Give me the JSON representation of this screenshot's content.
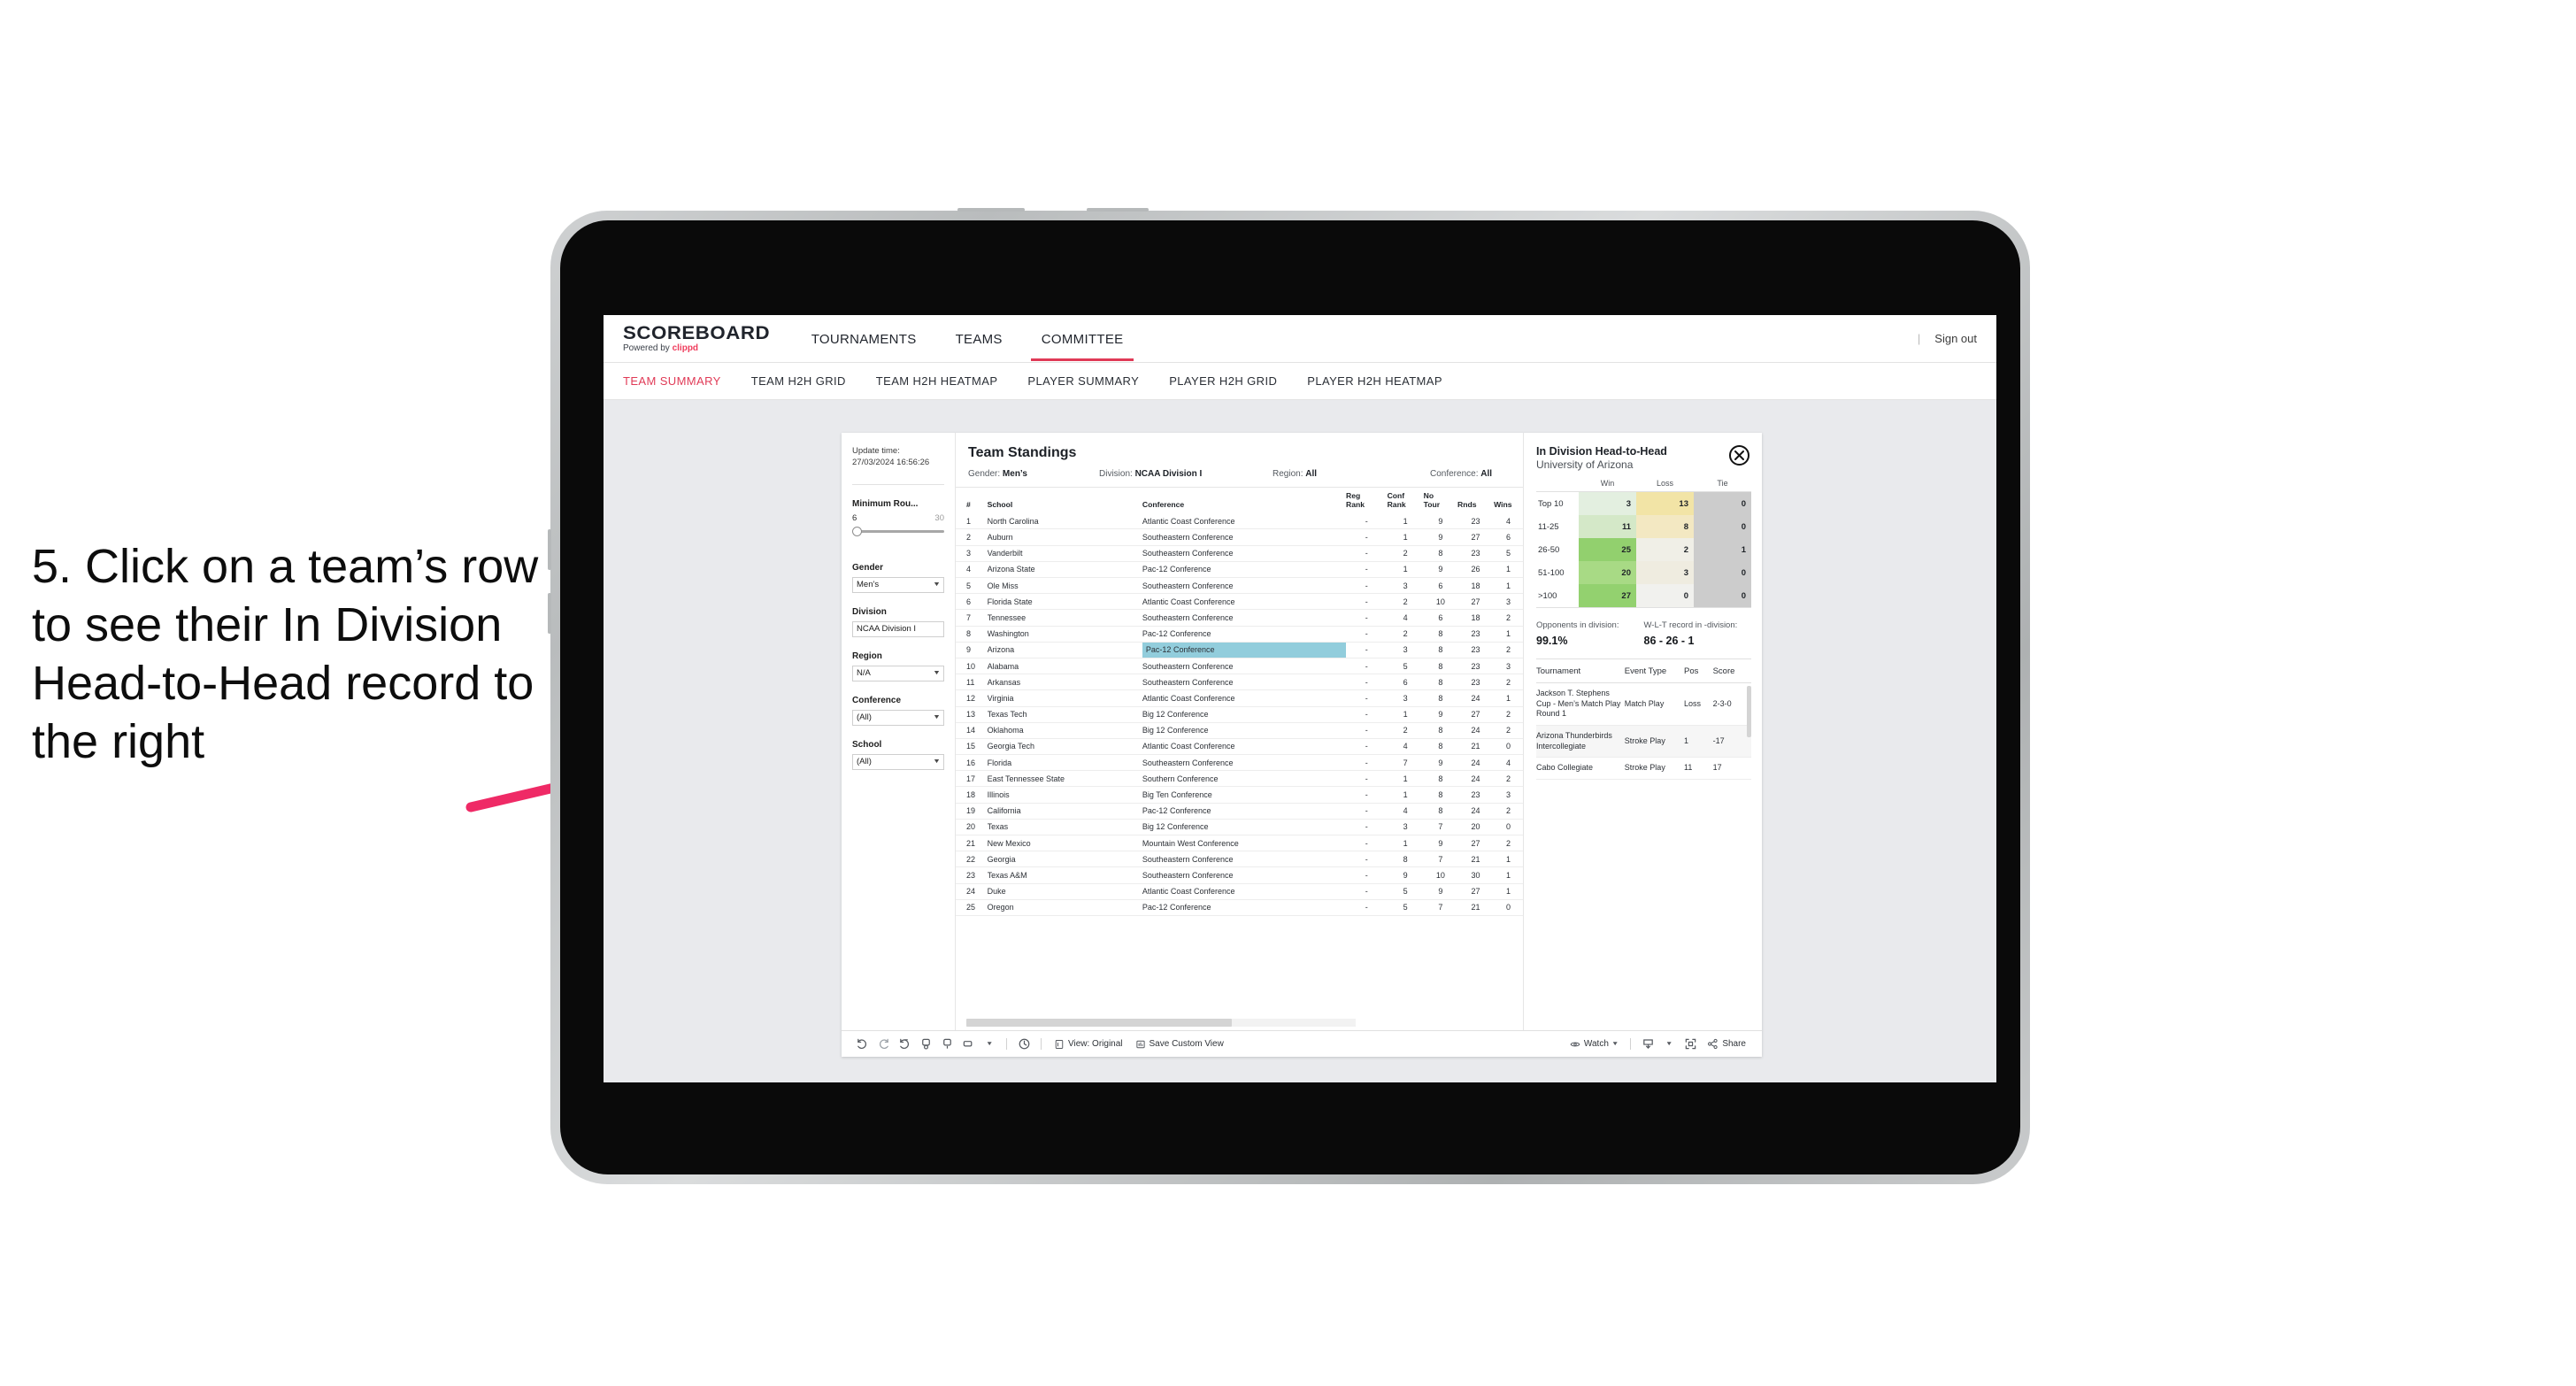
{
  "instruction": "5. Click on a team’s row to see their In Division Head-to-Head record to the right",
  "colors": {
    "accent": "#e03a56",
    "arrow": "#ef2a66",
    "highlight": "#92cddc"
  },
  "header": {
    "logo_main": "SCOREBOARD",
    "logo_powered": "Powered by ",
    "logo_brand": "clippd",
    "nav": [
      {
        "label": "TOURNAMENTS",
        "active": false
      },
      {
        "label": "TEAMS",
        "active": false
      },
      {
        "label": "COMMITTEE",
        "active": true
      }
    ],
    "divider": "|",
    "sign_out": "Sign out"
  },
  "subnav": [
    {
      "label": "TEAM SUMMARY",
      "active": true
    },
    {
      "label": "TEAM H2H GRID",
      "active": false
    },
    {
      "label": "TEAM H2H HEATMAP",
      "active": false
    },
    {
      "label": "PLAYER SUMMARY",
      "active": false
    },
    {
      "label": "PLAYER H2H GRID",
      "active": false
    },
    {
      "label": "PLAYER H2H HEATMAP",
      "active": false
    }
  ],
  "filters": {
    "update_label": "Update time:",
    "update_value": "27/03/2024 16:56:26",
    "min_rounds": {
      "label": "Minimum Rou...",
      "min": "6",
      "max": "30"
    },
    "gender": {
      "label": "Gender",
      "value": "Men’s"
    },
    "division": {
      "label": "Division",
      "value": "NCAA Division I"
    },
    "region": {
      "label": "Region",
      "value": "N/A"
    },
    "conference": {
      "label": "Conference",
      "value": "(All)"
    },
    "school": {
      "label": "School",
      "value": "(All)"
    }
  },
  "standings": {
    "title": "Team Standings",
    "meta": [
      {
        "label": "Gender: ",
        "value": "Men’s"
      },
      {
        "label": "Division: ",
        "value": "NCAA Division I"
      },
      {
        "label": "Region: ",
        "value": "All"
      },
      {
        "label": "Conference: ",
        "value": "All"
      }
    ],
    "columns": [
      "#",
      "School",
      "Conference",
      "Reg Rank",
      "Conf Rank",
      "No Tour",
      "Rnds",
      "Wins"
    ],
    "rows": [
      [
        "1",
        "North Carolina",
        "Atlantic Coast Conference",
        "-",
        "1",
        "9",
        "23",
        "4"
      ],
      [
        "2",
        "Auburn",
        "Southeastern Conference",
        "-",
        "1",
        "9",
        "27",
        "6"
      ],
      [
        "3",
        "Vanderbilt",
        "Southeastern Conference",
        "-",
        "2",
        "8",
        "23",
        "5"
      ],
      [
        "4",
        "Arizona State",
        "Pac-12 Conference",
        "-",
        "1",
        "9",
        "26",
        "1"
      ],
      [
        "5",
        "Ole Miss",
        "Southeastern Conference",
        "-",
        "3",
        "6",
        "18",
        "1"
      ],
      [
        "6",
        "Florida State",
        "Atlantic Coast Conference",
        "-",
        "2",
        "10",
        "27",
        "3"
      ],
      [
        "7",
        "Tennessee",
        "Southeastern Conference",
        "-",
        "4",
        "6",
        "18",
        "2"
      ],
      [
        "8",
        "Washington",
        "Pac-12 Conference",
        "-",
        "2",
        "8",
        "23",
        "1"
      ],
      [
        "9",
        "Arizona",
        "Pac-12 Conference",
        "-",
        "3",
        "8",
        "23",
        "2"
      ],
      [
        "10",
        "Alabama",
        "Southeastern Conference",
        "-",
        "5",
        "8",
        "23",
        "3"
      ],
      [
        "11",
        "Arkansas",
        "Southeastern Conference",
        "-",
        "6",
        "8",
        "23",
        "2"
      ],
      [
        "12",
        "Virginia",
        "Atlantic Coast Conference",
        "-",
        "3",
        "8",
        "24",
        "1"
      ],
      [
        "13",
        "Texas Tech",
        "Big 12 Conference",
        "-",
        "1",
        "9",
        "27",
        "2"
      ],
      [
        "14",
        "Oklahoma",
        "Big 12 Conference",
        "-",
        "2",
        "8",
        "24",
        "2"
      ],
      [
        "15",
        "Georgia Tech",
        "Atlantic Coast Conference",
        "-",
        "4",
        "8",
        "21",
        "0"
      ],
      [
        "16",
        "Florida",
        "Southeastern Conference",
        "-",
        "7",
        "9",
        "24",
        "4"
      ],
      [
        "17",
        "East Tennessee State",
        "Southern Conference",
        "-",
        "1",
        "8",
        "24",
        "2"
      ],
      [
        "18",
        "Illinois",
        "Big Ten Conference",
        "-",
        "1",
        "8",
        "23",
        "3"
      ],
      [
        "19",
        "California",
        "Pac-12 Conference",
        "-",
        "4",
        "8",
        "24",
        "2"
      ],
      [
        "20",
        "Texas",
        "Big 12 Conference",
        "-",
        "3",
        "7",
        "20",
        "0"
      ],
      [
        "21",
        "New Mexico",
        "Mountain West Conference",
        "-",
        "1",
        "9",
        "27",
        "2"
      ],
      [
        "22",
        "Georgia",
        "Southeastern Conference",
        "-",
        "8",
        "7",
        "21",
        "1"
      ],
      [
        "23",
        "Texas A&M",
        "Southeastern Conference",
        "-",
        "9",
        "10",
        "30",
        "1"
      ],
      [
        "24",
        "Duke",
        "Atlantic Coast Conference",
        "-",
        "5",
        "9",
        "27",
        "1"
      ],
      [
        "25",
        "Oregon",
        "Pac-12 Conference",
        "-",
        "5",
        "7",
        "21",
        "0"
      ]
    ],
    "selected_row_index": 8
  },
  "h2h": {
    "title": "In Division Head-to-Head",
    "subtitle": "University of Arizona",
    "close_icon": "close-icon",
    "heatmap": {
      "columns": [
        "Win",
        "Loss",
        "Tie"
      ],
      "rows": [
        {
          "label": "Top 10",
          "win": "3",
          "loss": "13",
          "tie": "0",
          "win_bg": "#e3efe0",
          "loss_bg": "#f2e4a6",
          "tie_bg": "#cccccc"
        },
        {
          "label": "11-25",
          "win": "11",
          "loss": "8",
          "tie": "0",
          "win_bg": "#d4e8c8",
          "loss_bg": "#f3e8c2",
          "tie_bg": "#cccccc"
        },
        {
          "label": "26-50",
          "win": "25",
          "loss": "2",
          "tie": "1",
          "win_bg": "#92d06e",
          "loss_bg": "#f0efe7",
          "tie_bg": "#cccccc"
        },
        {
          "label": "51-100",
          "win": "20",
          "loss": "3",
          "tie": "0",
          "win_bg": "#a8da85",
          "loss_bg": "#efece0",
          "tie_bg": "#cccccc"
        },
        {
          "label": ">100",
          "win": "27",
          "loss": "0",
          "tie": "0",
          "win_bg": "#93d16f",
          "loss_bg": "#f1f1ee",
          "tie_bg": "#cccccc"
        }
      ]
    },
    "stats": [
      {
        "caption": "Opponents in division:",
        "value": "99.1%"
      },
      {
        "caption": "W-L-T record in -division:",
        "value": "86 - 26 - 1"
      }
    ],
    "tournaments": {
      "columns": [
        "Tournament",
        "Event Type",
        "Pos",
        "Score"
      ],
      "rows": [
        [
          "Jackson T. Stephens Cup - Men’s Match Play Round 1",
          "Match Play",
          "Loss",
          "2-3-0"
        ],
        [
          "Arizona Thunderbirds Intercollegiate",
          "Stroke Play",
          "1",
          "-17"
        ],
        [
          "Cabo Collegiate",
          "Stroke Play",
          "11",
          "17"
        ]
      ]
    }
  },
  "toolbar": {
    "icons": [
      "undo-icon",
      "redo-icon",
      "revert-icon",
      "pause-icon",
      "refresh-icon",
      "device-icon"
    ],
    "view_label": "View: Original",
    "save_label": "Save Custom View",
    "watch_label": "Watch",
    "share_label": "Share"
  }
}
